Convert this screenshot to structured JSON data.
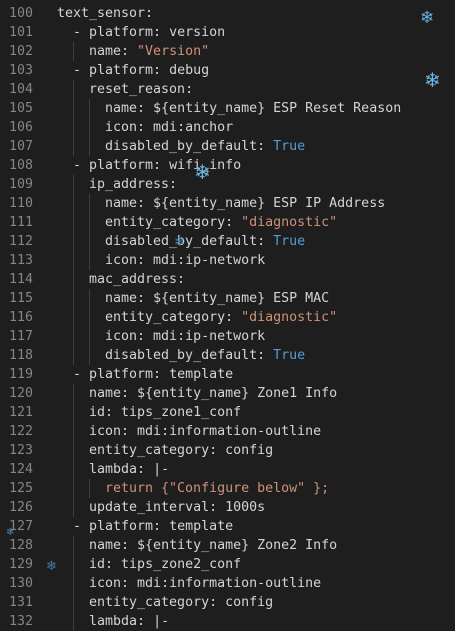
{
  "editor": {
    "lines": [
      {
        "num": "100",
        "indent": 0,
        "dash": false,
        "key": "text_sensor:",
        "val": "",
        "val_type": ""
      },
      {
        "num": "101",
        "indent": 1,
        "dash": true,
        "key": "platform:",
        "val": "version",
        "val_type": "plain"
      },
      {
        "num": "102",
        "indent": 2,
        "dash": false,
        "key": "name:",
        "val": "\"Version\"",
        "val_type": "string"
      },
      {
        "num": "103",
        "indent": 1,
        "dash": true,
        "key": "platform:",
        "val": "debug",
        "val_type": "plain"
      },
      {
        "num": "104",
        "indent": 2,
        "dash": false,
        "key": "reset_reason:",
        "val": "",
        "val_type": ""
      },
      {
        "num": "105",
        "indent": 3,
        "dash": false,
        "key": "name:",
        "val": "${entity_name} ESP Reset Reason",
        "val_type": "plain"
      },
      {
        "num": "106",
        "indent": 3,
        "dash": false,
        "key": "icon:",
        "val": "mdi:anchor",
        "val_type": "plain"
      },
      {
        "num": "107",
        "indent": 3,
        "dash": false,
        "key": "disabled_by_default:",
        "val": "True",
        "val_type": "keyword"
      },
      {
        "num": "108",
        "indent": 1,
        "dash": true,
        "key": "platform:",
        "val": "wifi_info",
        "val_type": "plain"
      },
      {
        "num": "109",
        "indent": 2,
        "dash": false,
        "key": "ip_address:",
        "val": "",
        "val_type": ""
      },
      {
        "num": "110",
        "indent": 3,
        "dash": false,
        "key": "name:",
        "val": "${entity_name} ESP IP Address",
        "val_type": "plain"
      },
      {
        "num": "111",
        "indent": 3,
        "dash": false,
        "key": "entity_category:",
        "val": "\"diagnostic\"",
        "val_type": "string"
      },
      {
        "num": "112",
        "indent": 3,
        "dash": false,
        "key": "disabled_by_default:",
        "val": "True",
        "val_type": "keyword"
      },
      {
        "num": "113",
        "indent": 3,
        "dash": false,
        "key": "icon:",
        "val": "mdi:ip-network",
        "val_type": "plain"
      },
      {
        "num": "114",
        "indent": 2,
        "dash": false,
        "key": "mac_address:",
        "val": "",
        "val_type": ""
      },
      {
        "num": "115",
        "indent": 3,
        "dash": false,
        "key": "name:",
        "val": "${entity_name} ESP MAC",
        "val_type": "plain"
      },
      {
        "num": "116",
        "indent": 3,
        "dash": false,
        "key": "entity_category:",
        "val": "\"diagnostic\"",
        "val_type": "string"
      },
      {
        "num": "117",
        "indent": 3,
        "dash": false,
        "key": "icon:",
        "val": "mdi:ip-network",
        "val_type": "plain"
      },
      {
        "num": "118",
        "indent": 3,
        "dash": false,
        "key": "disabled_by_default:",
        "val": "True",
        "val_type": "keyword"
      },
      {
        "num": "119",
        "indent": 1,
        "dash": true,
        "key": "platform:",
        "val": "template",
        "val_type": "plain"
      },
      {
        "num": "120",
        "indent": 2,
        "dash": false,
        "key": "name:",
        "val": "${entity_name} Zone1 Info",
        "val_type": "plain"
      },
      {
        "num": "121",
        "indent": 2,
        "dash": false,
        "key": "id:",
        "val": "tips_zone1_conf",
        "val_type": "plain"
      },
      {
        "num": "122",
        "indent": 2,
        "dash": false,
        "key": "icon:",
        "val": "mdi:information-outline",
        "val_type": "plain"
      },
      {
        "num": "123",
        "indent": 2,
        "dash": false,
        "key": "entity_category:",
        "val": "config",
        "val_type": "plain"
      },
      {
        "num": "124",
        "indent": 2,
        "dash": false,
        "key": "lambda:",
        "val": "|-",
        "val_type": "plain"
      },
      {
        "num": "125",
        "indent": 3,
        "dash": false,
        "key": "",
        "val": "return {\"Configure below\" };",
        "val_type": "string"
      },
      {
        "num": "126",
        "indent": 2,
        "dash": false,
        "key": "update_interval:",
        "val": "1000s",
        "val_type": "plain"
      },
      {
        "num": "127",
        "indent": 1,
        "dash": true,
        "key": "platform:",
        "val": "template",
        "val_type": "plain"
      },
      {
        "num": "128",
        "indent": 2,
        "dash": false,
        "key": "name:",
        "val": "${entity_name} Zone2 Info",
        "val_type": "plain"
      },
      {
        "num": "129",
        "indent": 2,
        "dash": false,
        "key": "id:",
        "val": "tips_zone2_conf",
        "val_type": "plain"
      },
      {
        "num": "130",
        "indent": 2,
        "dash": false,
        "key": "icon:",
        "val": "mdi:information-outline",
        "val_type": "plain"
      },
      {
        "num": "131",
        "indent": 2,
        "dash": false,
        "key": "entity_category:",
        "val": "config",
        "val_type": "plain"
      },
      {
        "num": "132",
        "indent": 2,
        "dash": false,
        "key": "lambda:",
        "val": "|-",
        "val_type": "plain"
      }
    ]
  },
  "theme": {
    "background": "#1e1e1e",
    "gutter_color": "#858585",
    "text_color": "#d4d4d4",
    "string_color": "#ce9178",
    "keyword_color": "#569cd6",
    "snowflake_color": "#5fa8d8"
  },
  "decorations": {
    "snowflake_icon": "❄"
  }
}
